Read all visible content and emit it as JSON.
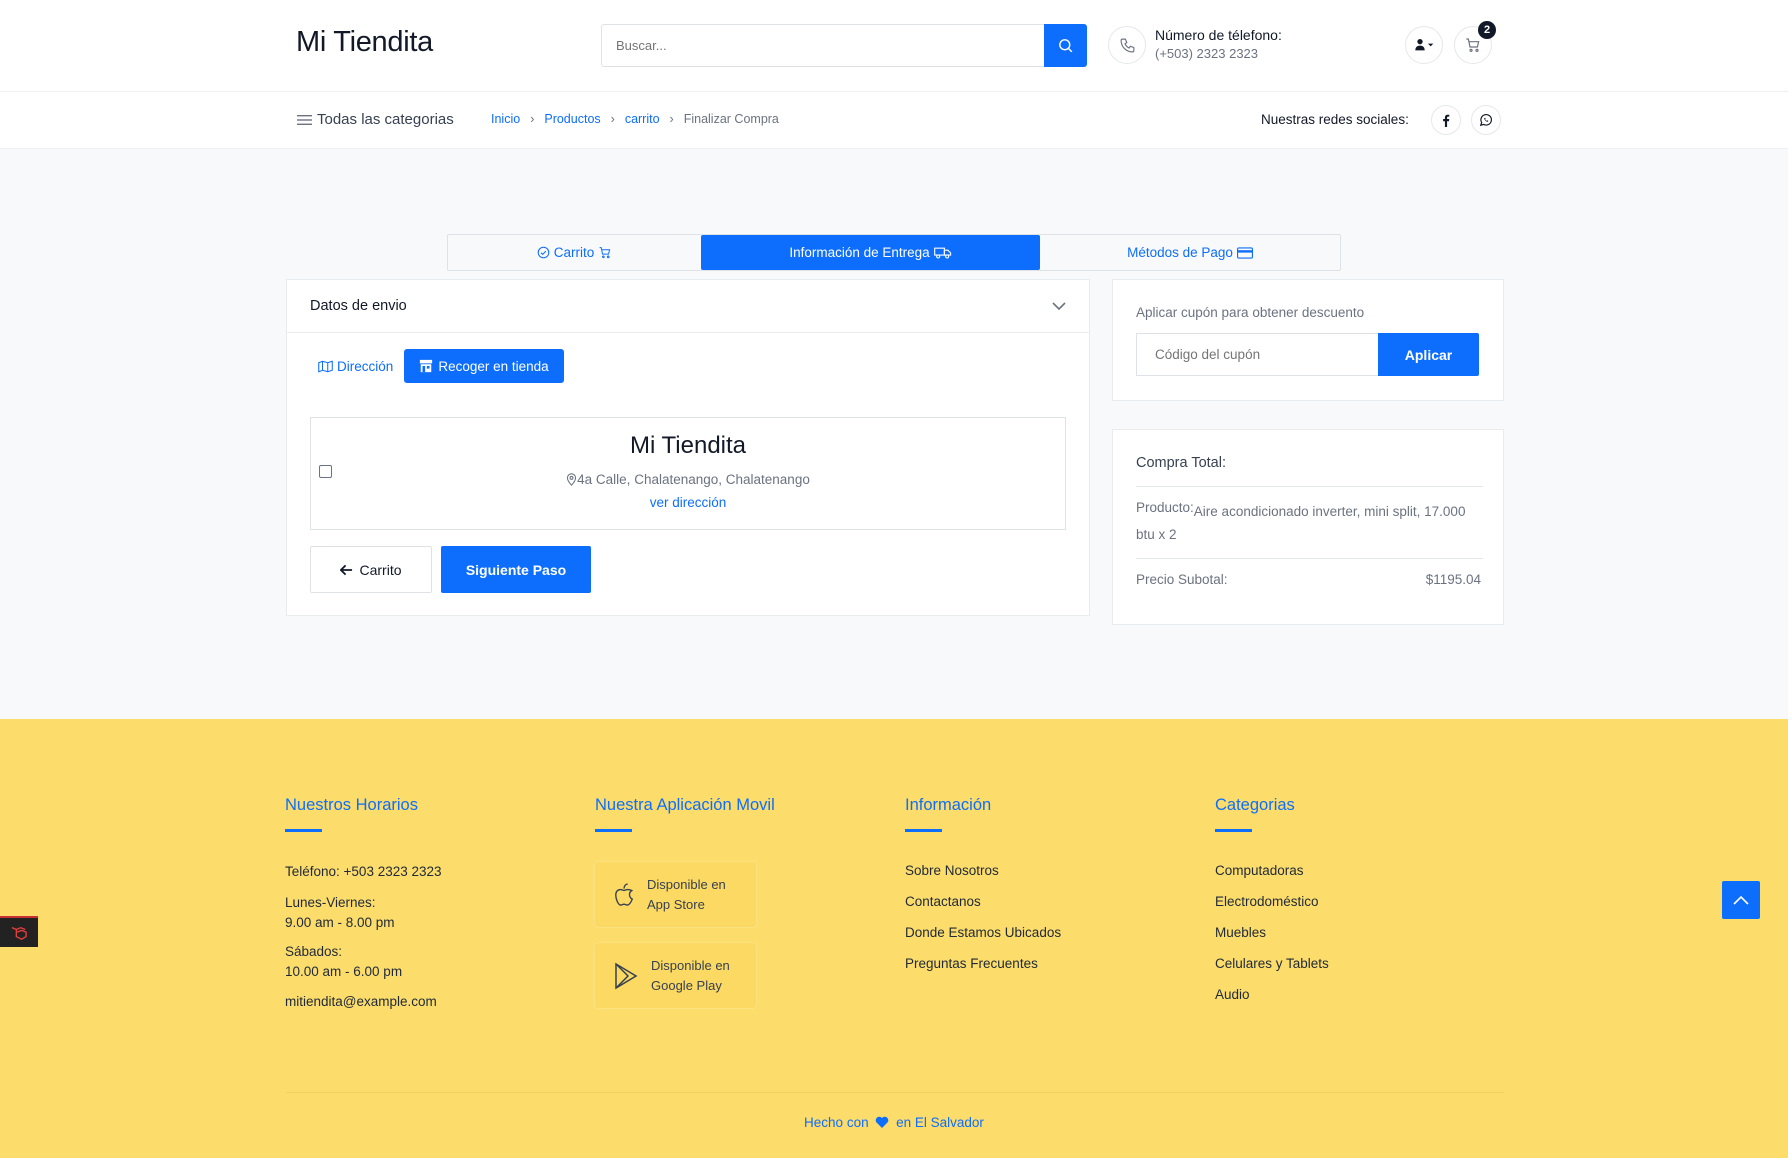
{
  "header": {
    "logo": "Mi Tiendita",
    "search_placeholder": "Buscar...",
    "phone_title": "Número de télefono:",
    "phone_number": "(+503) 2323 2323",
    "cart_count": "2"
  },
  "subnav": {
    "all_categories": "Todas las categorias",
    "breadcrumbs": [
      "Inicio",
      "Productos",
      "carrito",
      "Finalizar Compra"
    ],
    "social_label": "Nuestras redes sociales:"
  },
  "stepper": {
    "steps": [
      "Carrito",
      "Información de Entrega",
      "Métodos de Pago"
    ],
    "active_index": 1
  },
  "shipping": {
    "title": "Datos de envio",
    "tab_address": "Dirección",
    "tab_pickup": "Recoger en tienda",
    "store_name": "Mi Tiendita",
    "store_address": "4a Calle, Chalatenango, Chalatenango",
    "store_link": "ver dirección",
    "back_button": "Carrito",
    "next_button": "Siguiente Paso"
  },
  "coupon": {
    "label": "Aplicar cupón para obtener descuento",
    "placeholder": "Código del cupón",
    "button": "Aplicar"
  },
  "summary": {
    "title": "Compra Total:",
    "product_label": "Producto:",
    "product_value": "Aire acondicionado inverter, mini split, 17.000 btu x 2",
    "subtotal_label": "Precio Subotal:",
    "subtotal_value": "$1195.04"
  },
  "footer": {
    "hours": {
      "title": "Nuestros Horarios",
      "phone": "Teléfono: +503 2323 2323",
      "weekdays_label": "Lunes-Viernes:",
      "weekdays_hours": "9.00 am - 8.00 pm",
      "saturday_label": "Sábados:",
      "saturday_hours": "10.00 am - 6.00 pm",
      "email": "mitiendita@example.com"
    },
    "app": {
      "title": "Nuestra Aplicación Movil",
      "appstore_line1": "Disponible en",
      "appstore_line2": "App Store",
      "googleplay_line1": "Disponible en",
      "googleplay_line2": "Google Play"
    },
    "info": {
      "title": "Información",
      "links": [
        "Sobre Nosotros",
        "Contactanos",
        "Donde Estamos Ubicados",
        "Preguntas Frecuentes"
      ]
    },
    "categories": {
      "title": "Categorias",
      "links": [
        "Computadoras",
        "Electrodoméstico",
        "Muebles",
        "Celulares y Tablets",
        "Audio"
      ]
    },
    "made_prefix": "Hecho con",
    "made_suffix": "en El Salvador"
  },
  "colors": {
    "primary": "#0d6efd",
    "footer_bg": "#fcdc6a"
  }
}
